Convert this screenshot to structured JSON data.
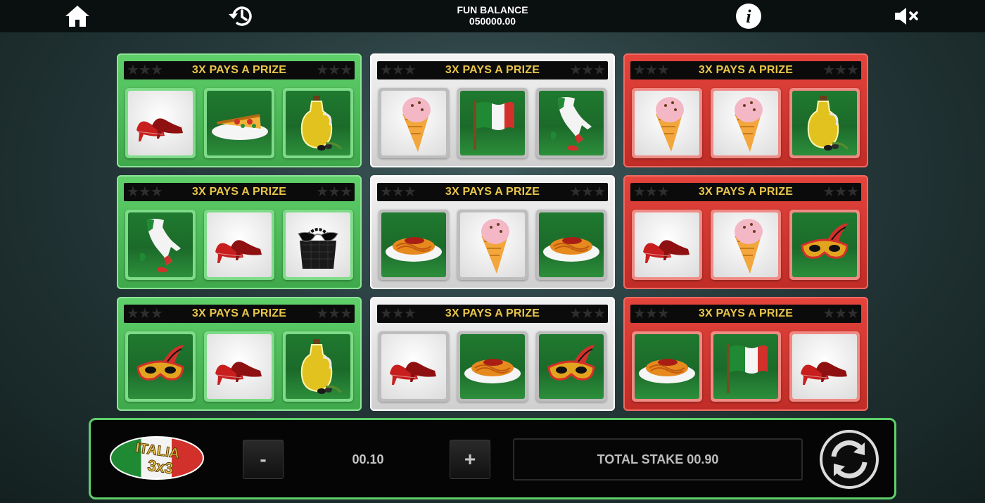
{
  "topbar": {
    "home_icon": "home-icon",
    "history_icon": "history-icon",
    "balance_label": "FUN BALANCE",
    "balance_value": "050000.00",
    "info_icon": "info-icon",
    "mute_icon": "mute-icon"
  },
  "colors": {
    "green": "#4bbf57",
    "white": "#e6e6e6",
    "red": "#d4362f",
    "banner_text": "#e9c64a",
    "panel_border": "#5fcf6a"
  },
  "cards": [
    {
      "color": "green",
      "banner": "3X PAYS A PRIZE",
      "symbols": [
        "shoes",
        "pizza",
        "olive-oil"
      ]
    },
    {
      "color": "white",
      "banner": "3X PAYS A PRIZE",
      "symbols": [
        "ice-cream",
        "flag",
        "map"
      ]
    },
    {
      "color": "red",
      "banner": "3X PAYS A PRIZE",
      "symbols": [
        "ice-cream",
        "ice-cream",
        "olive-oil"
      ]
    },
    {
      "color": "green",
      "banner": "3X PAYS A PRIZE",
      "symbols": [
        "map",
        "shoes",
        "handbag-sunglasses"
      ]
    },
    {
      "color": "white",
      "banner": "3X PAYS A PRIZE",
      "symbols": [
        "spaghetti",
        "ice-cream",
        "spaghetti"
      ]
    },
    {
      "color": "red",
      "banner": "3X PAYS A PRIZE",
      "symbols": [
        "shoes",
        "ice-cream",
        "mask"
      ]
    },
    {
      "color": "green",
      "banner": "3X PAYS A PRIZE",
      "symbols": [
        "mask",
        "shoes",
        "olive-oil"
      ]
    },
    {
      "color": "white",
      "banner": "3X PAYS A PRIZE",
      "symbols": [
        "shoes",
        "spaghetti",
        "mask"
      ]
    },
    {
      "color": "red",
      "banner": "3X PAYS A PRIZE",
      "symbols": [
        "spaghetti",
        "flag",
        "shoes"
      ]
    }
  ],
  "bottom": {
    "logo_line1": "ITALIA",
    "logo_line2": "3x3",
    "minus_label": "-",
    "stake_value": "00.10",
    "plus_label": "+",
    "total_stake_label": "TOTAL STAKE 00.90",
    "play_icon": "refresh-icon"
  }
}
